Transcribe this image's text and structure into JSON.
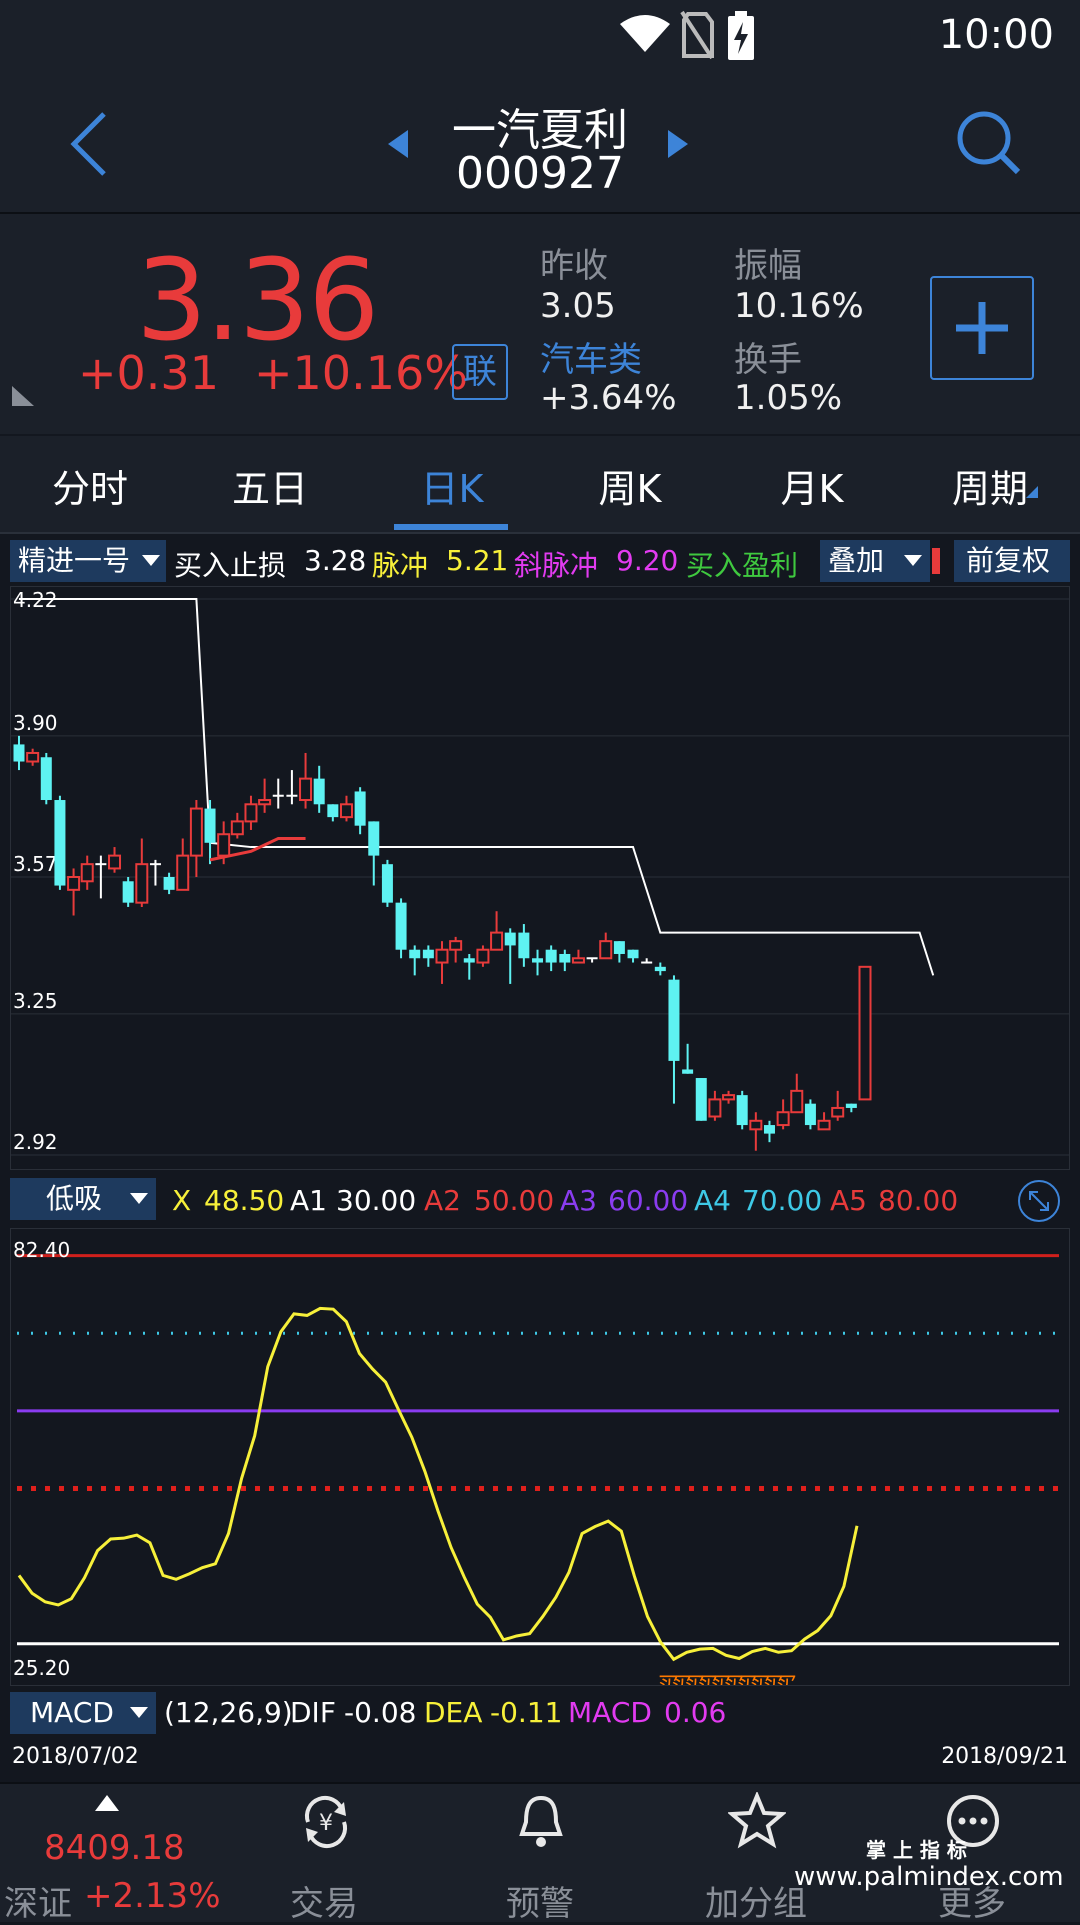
{
  "status_bar": {
    "time": "10:00"
  },
  "header": {
    "stock_name": "一汽夏利",
    "stock_code": "000927"
  },
  "quote": {
    "price": "3.36",
    "change": "+0.31",
    "change_pct": "+10.16%",
    "link_badge": "联",
    "prev_close_label": "昨收",
    "prev_close": "3.05",
    "amplitude_label": "振幅",
    "amplitude": "10.16%",
    "sector_label": "汽车类",
    "sector_change": "+3.64%",
    "turnover_label": "换手",
    "turnover": "1.05%"
  },
  "tabs": [
    {
      "label": "分时"
    },
    {
      "label": "五日"
    },
    {
      "label": "日K"
    },
    {
      "label": "周K"
    },
    {
      "label": "月K"
    },
    {
      "label": "周期"
    }
  ],
  "indicator_bar": {
    "selector": "精进一号",
    "stop_loss_label": "买入止损",
    "stop_loss": "3.28",
    "pulse_label": "脉冲",
    "pulse": "5.21",
    "slant_label": "斜脉冲",
    "slant": "9.20",
    "profit_label": "买入盈利",
    "overlay": "叠加",
    "adjust": "前复权"
  },
  "sub_indicator": {
    "selector": "低吸",
    "x_label": "X",
    "x": "48.50",
    "a1_label": "A1",
    "a1": "30.00",
    "a2_label": "A2",
    "a2": "50.00",
    "a3_label": "A3",
    "a3": "60.00",
    "a4_label": "A4",
    "a4": "70.00",
    "a5_label": "A5",
    "a5": "80.00",
    "buy_marker": "买入"
  },
  "macd": {
    "selector": "MACD",
    "params": "(12,26,9)",
    "dif_label": "DIF",
    "dif": "-0.08",
    "dea_label": "DEA",
    "dea": "-0.11",
    "macd_label": "MACD",
    "macd": "0.06"
  },
  "dates": {
    "start": "2018/07/02",
    "end": "2018/09/21"
  },
  "bottom_nav": {
    "index_value": "8409.18",
    "index_name": "深证",
    "index_change": "+2.13%",
    "items": [
      {
        "label": "交易"
      },
      {
        "label": "预警"
      },
      {
        "label": "加分组"
      },
      {
        "label": "更多"
      }
    ]
  },
  "watermark": {
    "line1": "掌 上 指 标",
    "line2": "www.palmindex.com"
  },
  "colors": {
    "up": "#e83b3b",
    "down": "#5ef2f2",
    "accent": "#3d84d8",
    "yellow": "#f7f03a",
    "magenta": "#e23bf0",
    "green": "#3fc93f",
    "purple": "#8a3cf0"
  },
  "chart_data": [
    {
      "type": "candlestick",
      "y_ticks": [
        "4.22",
        "3.90",
        "3.57",
        "3.25",
        "2.92"
      ],
      "ylim": [
        2.92,
        4.22
      ],
      "candles": [
        [
          3.88,
          3.84,
          3.9,
          3.82
        ],
        [
          3.84,
          3.86,
          3.87,
          3.83
        ],
        [
          3.85,
          3.75,
          3.86,
          3.74
        ],
        [
          3.75,
          3.55,
          3.76,
          3.54
        ],
        [
          3.54,
          3.57,
          3.59,
          3.48
        ],
        [
          3.56,
          3.6,
          3.62,
          3.54
        ],
        [
          3.6,
          3.6,
          3.62,
          3.52
        ],
        [
          3.59,
          3.62,
          3.64,
          3.58
        ],
        [
          3.56,
          3.51,
          3.57,
          3.5
        ],
        [
          3.51,
          3.6,
          3.66,
          3.5
        ],
        [
          3.6,
          3.6,
          3.61,
          3.55
        ],
        [
          3.57,
          3.54,
          3.58,
          3.53
        ],
        [
          3.54,
          3.62,
          3.66,
          3.54
        ],
        [
          3.62,
          3.73,
          3.75,
          3.57
        ],
        [
          3.73,
          3.65,
          3.75,
          3.6
        ],
        [
          3.62,
          3.67,
          3.7,
          3.6
        ],
        [
          3.67,
          3.7,
          3.72,
          3.66
        ],
        [
          3.7,
          3.74,
          3.76,
          3.68
        ],
        [
          3.74,
          3.75,
          3.8,
          3.72
        ],
        [
          3.76,
          3.76,
          3.8,
          3.73
        ],
        [
          3.76,
          3.76,
          3.82,
          3.74
        ],
        [
          3.75,
          3.8,
          3.86,
          3.73
        ],
        [
          3.8,
          3.74,
          3.83,
          3.72
        ],
        [
          3.74,
          3.71,
          3.74,
          3.7
        ],
        [
          3.71,
          3.74,
          3.76,
          3.7
        ],
        [
          3.77,
          3.69,
          3.78,
          3.67
        ],
        [
          3.7,
          3.62,
          3.7,
          3.55
        ],
        [
          3.6,
          3.51,
          3.61,
          3.5
        ],
        [
          3.51,
          3.4,
          3.52,
          3.38
        ],
        [
          3.4,
          3.38,
          3.41,
          3.34
        ],
        [
          3.4,
          3.38,
          3.41,
          3.36
        ],
        [
          3.37,
          3.4,
          3.42,
          3.32
        ],
        [
          3.4,
          3.42,
          3.43,
          3.37
        ],
        [
          3.38,
          3.37,
          3.39,
          3.33
        ],
        [
          3.37,
          3.4,
          3.41,
          3.36
        ],
        [
          3.4,
          3.44,
          3.49,
          3.4
        ],
        [
          3.44,
          3.41,
          3.45,
          3.32
        ],
        [
          3.44,
          3.38,
          3.46,
          3.36
        ],
        [
          3.38,
          3.37,
          3.4,
          3.34
        ],
        [
          3.4,
          3.37,
          3.41,
          3.35
        ],
        [
          3.39,
          3.37,
          3.4,
          3.35
        ],
        [
          3.37,
          3.38,
          3.4,
          3.37
        ],
        [
          3.38,
          3.38,
          3.38,
          3.37
        ],
        [
          3.38,
          3.42,
          3.44,
          3.38
        ],
        [
          3.42,
          3.39,
          3.42,
          3.37
        ],
        [
          3.4,
          3.38,
          3.4,
          3.37
        ],
        [
          3.37,
          3.37,
          3.38,
          3.37
        ],
        [
          3.36,
          3.35,
          3.37,
          3.34
        ],
        [
          3.33,
          3.14,
          3.34,
          3.04
        ],
        [
          3.12,
          3.11,
          3.18,
          3.11
        ],
        [
          3.1,
          3.0,
          3.1,
          3.0
        ],
        [
          3.01,
          3.05,
          3.07,
          3.0
        ],
        [
          3.05,
          3.06,
          3.07,
          3.04
        ],
        [
          3.06,
          2.99,
          3.07,
          2.98
        ],
        [
          2.98,
          3.0,
          3.02,
          2.93
        ],
        [
          2.99,
          2.97,
          3.0,
          2.95
        ],
        [
          2.99,
          3.02,
          3.05,
          2.98
        ],
        [
          3.02,
          3.07,
          3.11,
          3.02
        ],
        [
          3.04,
          2.99,
          3.05,
          2.98
        ],
        [
          2.98,
          3.0,
          3.02,
          2.98
        ],
        [
          3.01,
          3.03,
          3.07,
          3.0
        ],
        [
          3.04,
          3.03,
          3.04,
          3.02
        ],
        [
          3.05,
          3.36,
          3.36,
          3.05
        ]
      ],
      "stop_line": [
        [
          0,
          4.22
        ],
        [
          13,
          4.22
        ],
        [
          14,
          3.65
        ],
        [
          17,
          3.64
        ],
        [
          26,
          3.64
        ],
        [
          45,
          3.64
        ],
        [
          47,
          3.44
        ],
        [
          66,
          3.44
        ],
        [
          67,
          3.34
        ]
      ],
      "red_line": [
        [
          14,
          3.61
        ],
        [
          17,
          3.63
        ],
        [
          19,
          3.66
        ],
        [
          21,
          3.66
        ]
      ]
    },
    {
      "type": "line",
      "y_ticks": [
        "82.40",
        "25.20"
      ],
      "ylim": [
        25.2,
        82.4
      ],
      "levels": {
        "a1": 30.0,
        "a2": 50.0,
        "a3": 60.0,
        "a4": 70.0,
        "a5": 80.0
      },
      "values": [
        38.8,
        36.5,
        35.4,
        35.0,
        35.8,
        38.5,
        42.0,
        43.5,
        43.6,
        44.0,
        43.0,
        38.8,
        38.3,
        39.0,
        39.8,
        40.3,
        44.2,
        51.3,
        56.8,
        65.7,
        70.2,
        72.5,
        72.3,
        73.2,
        73.1,
        71.5,
        67.4,
        65.4,
        63.7,
        60.1,
        56.6,
        52.2,
        47.1,
        42.4,
        38.6,
        35.1,
        33.4,
        30.5,
        31.0,
        31.3,
        33.5,
        36.0,
        39.2,
        44.2,
        45.1,
        45.8,
        44.5,
        38.7,
        33.5,
        30.2,
        28.0,
        28.9,
        29.3,
        29.4,
        28.5,
        28.1,
        29.0,
        29.4,
        28.9,
        29.1,
        30.6,
        31.7,
        33.6,
        37.4,
        45.2
      ]
    }
  ]
}
